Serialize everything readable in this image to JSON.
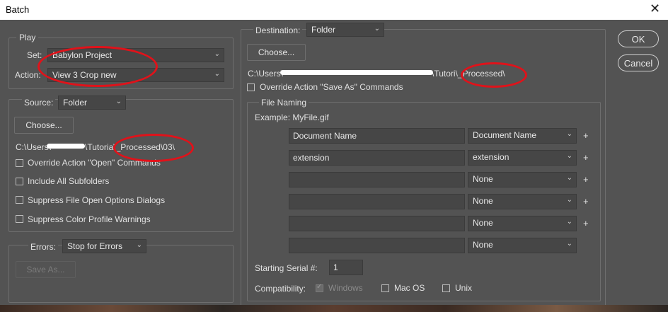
{
  "window": {
    "title": "Batch",
    "close_glyph": "✕"
  },
  "buttons": {
    "ok": "OK",
    "cancel": "Cancel"
  },
  "play": {
    "legend": "Play",
    "set_label": "Set:",
    "set_value": "Babylon Project",
    "action_label": "Action:",
    "action_value": "View 3 Crop new"
  },
  "source": {
    "label": "Source:",
    "value": "Folder",
    "choose_label": "Choose...",
    "path_start": "C:\\Users\\",
    "path_mid": "\\Tutoria",
    "path_end": "\\_Processed\\03\\",
    "checkboxes": [
      {
        "label": "Override Action \"Open\" Commands",
        "checked": false
      },
      {
        "label": "Include All Subfolders",
        "checked": false
      },
      {
        "label": "Suppress File Open Options Dialogs",
        "checked": false
      },
      {
        "label": "Suppress Color Profile Warnings",
        "checked": false
      }
    ]
  },
  "errors": {
    "label": "Errors:",
    "value": "Stop for Errors",
    "save_as_label": "Save As..."
  },
  "destination": {
    "label": "Destination:",
    "value": "Folder",
    "choose_label": "Choose...",
    "path_start": "C:\\Users\\",
    "path_mid": "\\Tutori",
    "path_end": "\\_Processed\\",
    "override_label": "Override Action \"Save As\" Commands",
    "override_checked": false
  },
  "file_naming": {
    "legend": "File Naming",
    "example": "Example: MyFile.gif",
    "rows": [
      {
        "text": "Document Name",
        "select": "Document Name",
        "plus": "+"
      },
      {
        "text": "extension",
        "select": "extension",
        "plus": "+"
      },
      {
        "text": "",
        "select": "None",
        "plus": "+"
      },
      {
        "text": "",
        "select": "None",
        "plus": "+"
      },
      {
        "text": "",
        "select": "None",
        "plus": "+"
      },
      {
        "text": "",
        "select": "None",
        "plus": ""
      }
    ],
    "serial_label": "Starting Serial #:",
    "serial_value": "1",
    "compat_label": "Compatibility:",
    "compat_windows": "Windows",
    "compat_mac": "Mac OS",
    "compat_unix": "Unix"
  },
  "colors": {
    "background": "#535353",
    "annotation": "#e0121a"
  }
}
